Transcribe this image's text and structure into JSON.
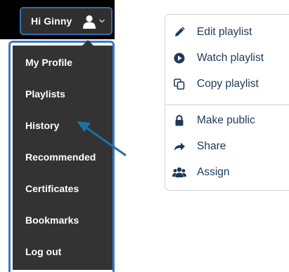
{
  "header": {
    "greeting": "Hi Ginny"
  },
  "menu": {
    "items": [
      {
        "label": "My Profile"
      },
      {
        "label": "Playlists"
      },
      {
        "label": "History"
      },
      {
        "label": "Recommended"
      },
      {
        "label": "Certificates"
      },
      {
        "label": "Bookmarks"
      },
      {
        "label": "Log out"
      }
    ]
  },
  "actions": {
    "edit": {
      "label": "Edit playlist",
      "icon": "pencil-icon"
    },
    "watch": {
      "label": "Watch playlist",
      "icon": "play-circle-icon"
    },
    "copy": {
      "label": "Copy playlist",
      "icon": "copy-icon"
    },
    "make_public": {
      "label": "Make public",
      "icon": "lock-icon"
    },
    "share": {
      "label": "Share",
      "icon": "share-arrow-icon"
    },
    "assign": {
      "label": "Assign",
      "icon": "users-icon"
    }
  },
  "colors": {
    "menu_bg": "#333333",
    "accent_blue": "#3b79c4",
    "action_text": "#1d3a59",
    "annotation_arrow": "#1f6fa8"
  }
}
